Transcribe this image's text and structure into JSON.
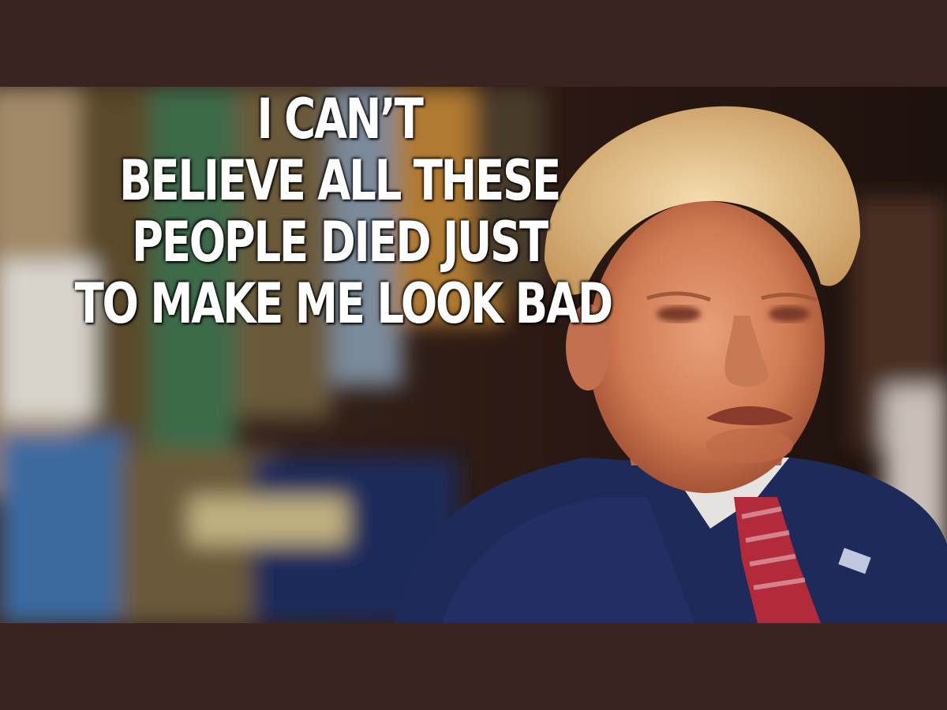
{
  "meme": {
    "caption_lines": [
      "I CAN’T",
      "BELIEVE ALL THESE",
      "PEOPLE DIED JUST",
      "TO MAKE ME LOOK BAD"
    ]
  },
  "colors": {
    "letterbox": "#3a2421",
    "caption_text": "#ffffff",
    "suit": "#1e2a5a",
    "hair": "#e8c890",
    "skin": "#d98a60",
    "tie_red": "#b32a3a"
  }
}
